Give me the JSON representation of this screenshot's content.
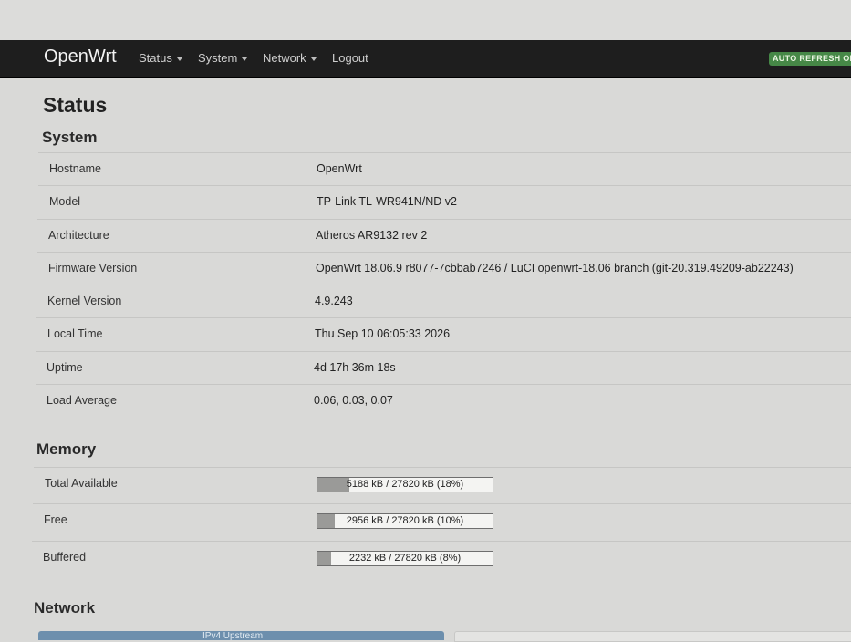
{
  "navbar": {
    "brand": "OpenWrt",
    "menu": [
      {
        "label": "Status"
      },
      {
        "label": "System"
      },
      {
        "label": "Network"
      },
      {
        "label": "Logout"
      }
    ],
    "auto_refresh": "AUTO REFRESH ON"
  },
  "page_title": "Status",
  "system": {
    "title": "System",
    "rows": [
      {
        "label": "Hostname",
        "value": "OpenWrt"
      },
      {
        "label": "Model",
        "value": "TP-Link TL-WR941N/ND v2"
      },
      {
        "label": "Architecture",
        "value": "Atheros AR9132 rev 2"
      },
      {
        "label": "Firmware Version",
        "value": "OpenWrt 18.06.9 r8077-7cbbab7246 / LuCI openwrt-18.06 branch (git-20.319.49209-ab22243)"
      },
      {
        "label": "Kernel Version",
        "value": "4.9.243"
      },
      {
        "label": "Local Time",
        "value": "Thu Sep 10 06:05:33 2026"
      },
      {
        "label": "Uptime",
        "value": "4d 17h 36m 18s"
      },
      {
        "label": "Load Average",
        "value": "0.06, 0.03, 0.07"
      }
    ]
  },
  "memory": {
    "title": "Memory",
    "rows": [
      {
        "label": "Total Available",
        "text": "5188 kB / 27820 kB (18%)",
        "percent": 18
      },
      {
        "label": "Free",
        "text": "2956 kB / 27820 kB (10%)",
        "percent": 10
      },
      {
        "label": "Buffered",
        "text": "2232 kB / 27820 kB (8%)",
        "percent": 8
      }
    ]
  },
  "network": {
    "title": "Network",
    "tab_label": "IPv4 Upstream"
  },
  "colors": {
    "navbar_bg": "#1e1e1e",
    "badge_green": "#468847",
    "tab_blue": "#6d8fad"
  }
}
